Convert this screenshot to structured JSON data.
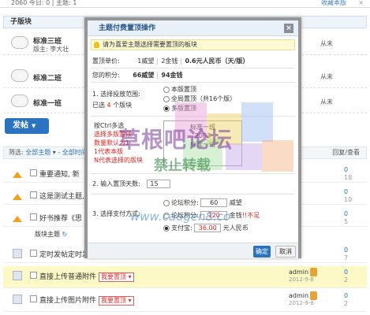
{
  "top_strip": {
    "left": "2060 今日: 0 | 主题: 1",
    "fav": "收藏本版",
    "close": "×"
  },
  "subforum_header": "子版块",
  "boards": [
    {
      "name": "标准三班",
      "moderator": "版主: 李大壮",
      "last": "从未"
    },
    {
      "name": "标准二班",
      "moderator": "",
      "last": "从未"
    },
    {
      "name": "标准一班",
      "moderator": "",
      "last": "从未"
    }
  ],
  "post_button": "发帖",
  "filter": {
    "label": "筛选:",
    "all_threads": "全部主题",
    "all_time": "全部时间",
    "reply_view": "回复/查看"
  },
  "threads": [
    {
      "title": "重要通知, 新",
      "author": "",
      "date": "",
      "c1": "0",
      "c2": "18",
      "type": "sticky"
    },
    {
      "title": "这是测试主题,",
      "author": "",
      "date": "",
      "c1": "0",
      "c2": "10",
      "type": "sticky"
    },
    {
      "title": "好书推荐《思",
      "author": "",
      "date": "",
      "c1": "0",
      "c2": "5",
      "type": "sticky"
    }
  ],
  "new_threads_label": "版块主题",
  "lower_threads": [
    {
      "title": "定时发帖定时发",
      "author": "",
      "date": "",
      "c1": "0",
      "c2": "7",
      "tag": "",
      "highlight": false
    },
    {
      "title": "直接上传普通附件",
      "author": "admin",
      "date": "2012-9-8",
      "c1": "0",
      "c2": "2",
      "tag": "我要置顶",
      "highlight": true
    },
    {
      "title": "直接上传图片附件",
      "author": "admin",
      "date": "2012-9-8",
      "c1": "0",
      "c2": "2",
      "tag": "我要置顶",
      "highlight": false
    }
  ],
  "modal": {
    "title": "主题付费置顶操作",
    "close": "×",
    "tip": "请为喜爱主题选择需要置顶的板块",
    "price_label": "置顶单价:",
    "price_1": "1威望",
    "price_2": "2金钱",
    "price_3": "0.6元人民币（天/版）",
    "points_label": "您的积分:",
    "points_1": "66威望",
    "points_2": "94金钱",
    "step1_label": "1. 选择投放范围:",
    "step1_selected_prefix": "已选",
    "step1_selected_count": "4",
    "step1_selected_suffix": "个版块",
    "scope_options": [
      "本版置顶",
      "全局置顶（共16个版）",
      "多版置顶"
    ],
    "ctrl_note": "按Ctrl多选",
    "ctrl_red_1": "选择多版置顶",
    "ctrl_red_2": "数量默认为1",
    "ctrl_red_3": "1代表本版",
    "ctrl_red_4": "N代表选择的版块",
    "listbox_items": [
      "标准一班",
      "",
      "2003",
      "标准一班"
    ],
    "step2_label": "2. 输入置顶天数:",
    "step2_value": "15",
    "step3_label": "3. 选择支付方式:",
    "pay_options": [
      {
        "label": "论坛积分:",
        "value": "60",
        "unit": "威望",
        "warn": ""
      },
      {
        "label": "论坛积分:",
        "value": "120",
        "unit": "金钱",
        "warn": "!!不足"
      },
      {
        "label": "支付宝:",
        "value": "36.00",
        "unit": "元人民币",
        "warn": ""
      }
    ],
    "ok": "确定",
    "cancel": "取消"
  },
  "watermark": {
    "line1": "草根吧论坛",
    "line2": "禁止转载",
    "line3": "www.caogen8.co",
    "line4": ""
  },
  "colors": {
    "accent": "#2b73c0",
    "warn": "#d22",
    "highlight_row": "#fdf9c6"
  }
}
